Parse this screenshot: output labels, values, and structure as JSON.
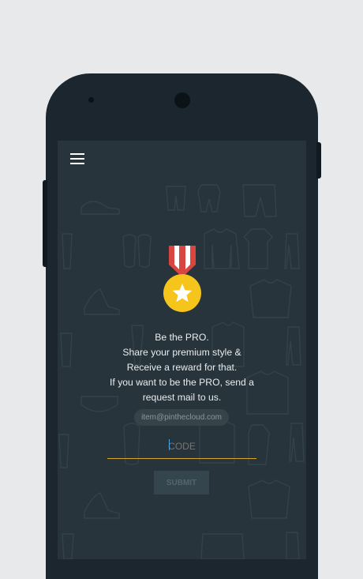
{
  "screen": {
    "message_lines": [
      "Be the PRO.",
      "Share your premium style &",
      "Receive a reward for that.",
      "If you want to be the PRO, send a",
      "request mail to us."
    ],
    "email": "item@pinthecloud.com",
    "code_placeholder": "CODE",
    "submit_label": "SUBMIT"
  },
  "icons": {
    "menu": "hamburger-menu-icon",
    "medal": "medal-star-icon"
  },
  "colors": {
    "page_background": "#e8e9ea",
    "phone_body": "#1b262e",
    "screen_background": "#27343b",
    "accent_underline": "#d7a72b",
    "medal_gold": "#f5c51b",
    "ribbon_red": "#d9453f"
  }
}
